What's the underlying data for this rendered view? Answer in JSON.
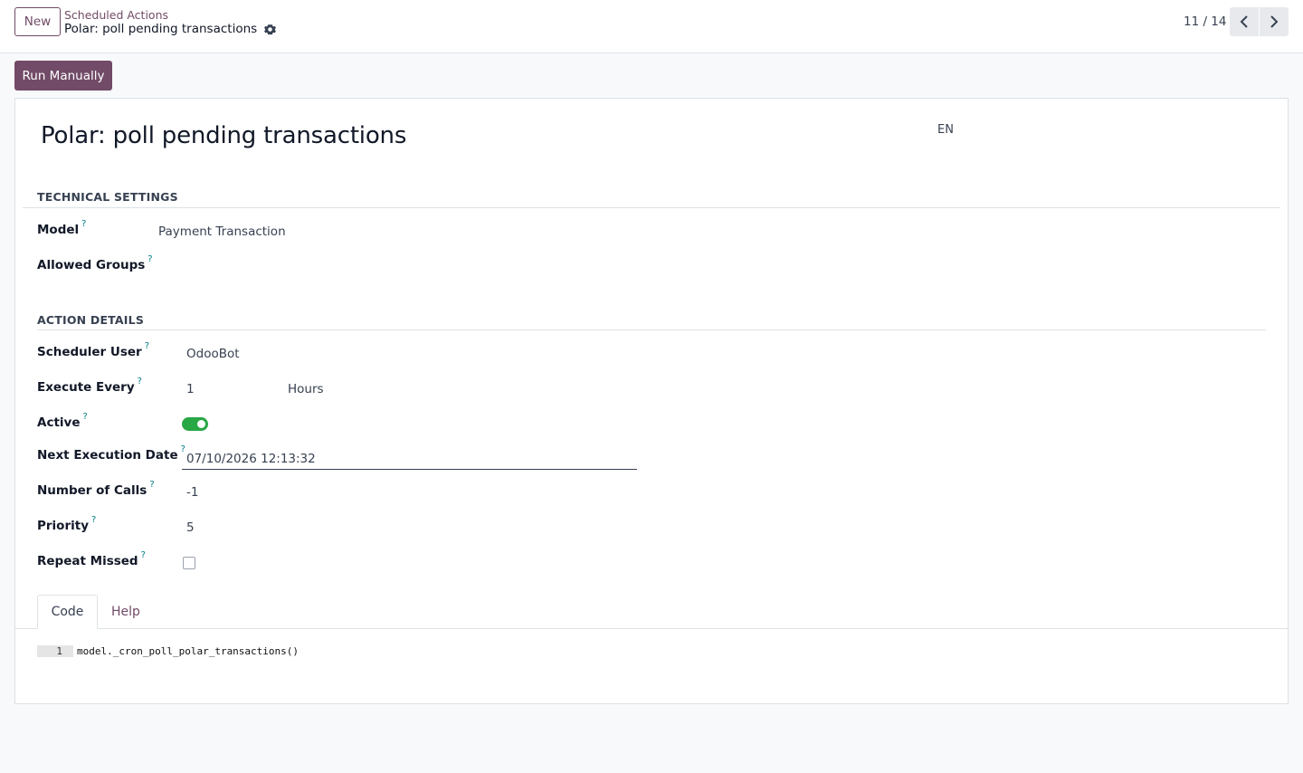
{
  "control_panel": {
    "new_label": "New",
    "breadcrumb_parent": "Scheduled Actions",
    "breadcrumb_current": "Polar: poll pending transactions",
    "pager_value": "11 / 14"
  },
  "actions": {
    "run_manually_label": "Run Manually"
  },
  "sheet": {
    "title": "Polar: poll pending transactions",
    "lang": "EN"
  },
  "technical_settings": {
    "title": "TECHNICAL SETTINGS",
    "model_label": "Model",
    "model_value": "Payment Transaction",
    "allowed_groups_label": "Allowed Groups",
    "help_mark": "?"
  },
  "action_details": {
    "title": "ACTION DETAILS",
    "scheduler_user_label": "Scheduler User",
    "scheduler_user_value": "OdooBot",
    "execute_every_label": "Execute Every",
    "execute_every_value": "1",
    "execute_every_unit": "Hours",
    "active_label": "Active",
    "active_value": true,
    "next_execution_label": "Next Execution Date",
    "next_execution_value": "07/10/2026 12:13:32",
    "number_of_calls_label": "Number of Calls",
    "number_of_calls_value": "-1",
    "priority_label": "Priority",
    "priority_value": "5",
    "repeat_missed_label": "Repeat Missed",
    "repeat_missed_value": false
  },
  "tabs": {
    "code_label": "Code",
    "help_label": "Help"
  },
  "code": {
    "line_number": "1",
    "line_text": "model._cron_poll_polar_transactions()"
  },
  "colors": {
    "brand": "#714b67",
    "toggle_on": "#28a745",
    "help_mark": "#017e84"
  }
}
